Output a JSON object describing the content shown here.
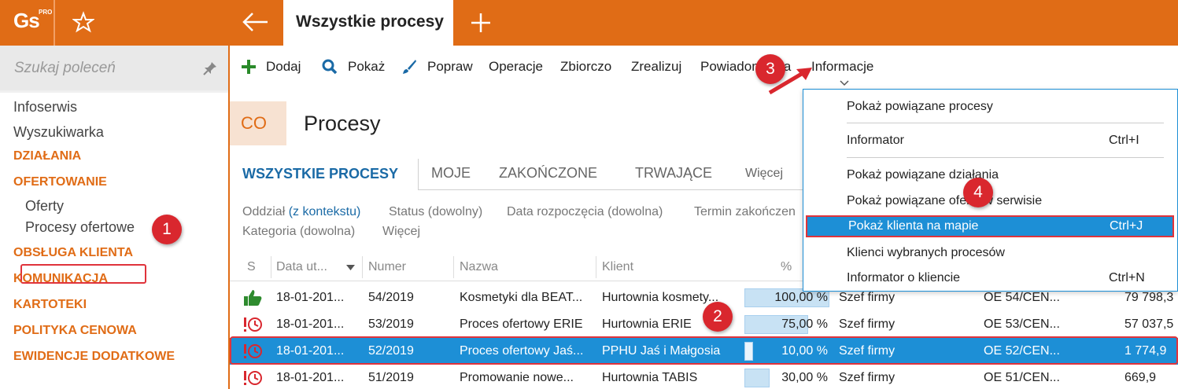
{
  "app": {
    "logo": "Gs",
    "logo_sup": "PRO",
    "active_tab": "Wszystkie procesy"
  },
  "sidebar": {
    "search_placeholder": "Szukaj poleceń",
    "items": [
      {
        "label": "Infoserwis",
        "kind": "item"
      },
      {
        "label": "Wyszukiwarka",
        "kind": "item"
      },
      {
        "label": "DZIAŁANIA",
        "kind": "cat"
      },
      {
        "label": "OFERTOWANIE",
        "kind": "cat"
      },
      {
        "label": "Oferty",
        "kind": "sub"
      },
      {
        "label": "Procesy ofertowe",
        "kind": "sub"
      },
      {
        "label": "OBSŁUGA KLIENTA",
        "kind": "cat"
      },
      {
        "label": "KOMUNIKACJA",
        "kind": "cat"
      },
      {
        "label": "KARTOTEKI",
        "kind": "cat"
      },
      {
        "label": "POLITYKA CENOWA",
        "kind": "cat"
      },
      {
        "label": "EWIDENCJE DODATKOWE",
        "kind": "cat"
      }
    ]
  },
  "toolbar": {
    "add": "Dodaj",
    "show": "Pokaż",
    "edit": "Popraw",
    "operations": "Operacje",
    "bulk": "Zbiorczo",
    "realize": "Zrealizuj",
    "notifications": "Powiadomienia",
    "info": "Informacje"
  },
  "page": {
    "badge": "CO",
    "title": "Procesy"
  },
  "tabs": [
    "WSZYSTKIE PROCESY",
    "MOJE",
    "ZAKOŃCZONE",
    "TRWAJĄCE",
    "Więcej"
  ],
  "filters": {
    "branch": "Oddział",
    "branch_link": "(z kontekstu)",
    "status": "Status (dowolny)",
    "start": "Data rozpoczęcia (dowolna)",
    "end": "Termin zakończen",
    "category": "Kategoria (dowolna)",
    "more": "Więcej"
  },
  "table": {
    "headers": [
      "S",
      "Data ut...",
      "Numer",
      "Nazwa",
      "Klient",
      "%"
    ],
    "rows": [
      {
        "icon": "thumbs-up",
        "date": "18-01-201...",
        "number": "54/2019",
        "name": "Kosmetyki dla BEAT...",
        "client": "Hurtownia kosmety...",
        "pct": "100,00 %",
        "pct_value": 100,
        "owner": "Szef firmy",
        "offer": "OE 54/CEN...",
        "amount": "79 798,3"
      },
      {
        "icon": "alert-clock",
        "date": "18-01-201...",
        "number": "53/2019",
        "name": "Proces ofertowy ERIE",
        "client": "Hurtownia ERIE",
        "pct": "75,00 %",
        "pct_value": 75,
        "owner": "Szef firmy",
        "offer": "OE 53/CEN...",
        "amount": "57 037,5"
      },
      {
        "icon": "alert-clock",
        "date": "18-01-201...",
        "number": "52/2019",
        "name": "Proces ofertowy Jaś...",
        "client": "PPHU Jaś i Małgosia",
        "pct": "10,00 %",
        "pct_value": 10,
        "owner": "Szef firmy",
        "offer": "OE 52/CEN...",
        "amount": "1 774,9"
      },
      {
        "icon": "alert-clock",
        "date": "18-01-201...",
        "number": "51/2019",
        "name": "Promowanie nowe...",
        "client": "Hurtownia TABIS",
        "pct": "30,00 %",
        "pct_value": 30,
        "owner": "Szef firmy",
        "offer": "OE 51/CEN...",
        "amount": "669,9"
      }
    ]
  },
  "dropdown": {
    "items": [
      {
        "label": "Pokaż powiązane procesy",
        "shortcut": ""
      },
      {
        "label": "Informator",
        "shortcut": "Ctrl+I"
      },
      {
        "label": "Pokaż powiązane działania",
        "shortcut": ""
      },
      {
        "label": "Pokaż powiązane oferty w serwisie",
        "shortcut": ""
      },
      {
        "label": "Pokaż klienta na mapie",
        "shortcut": "Ctrl+J"
      },
      {
        "label": "Klienci wybranych procesów",
        "shortcut": ""
      },
      {
        "label": "Informator o kliencie",
        "shortcut": "Ctrl+N"
      }
    ]
  },
  "badges": [
    "1",
    "2",
    "3",
    "4"
  ],
  "colors": {
    "accent": "#e06c16",
    "selection": "#1d8fd6",
    "marker": "#d9272e",
    "link": "#1a6aa6"
  }
}
